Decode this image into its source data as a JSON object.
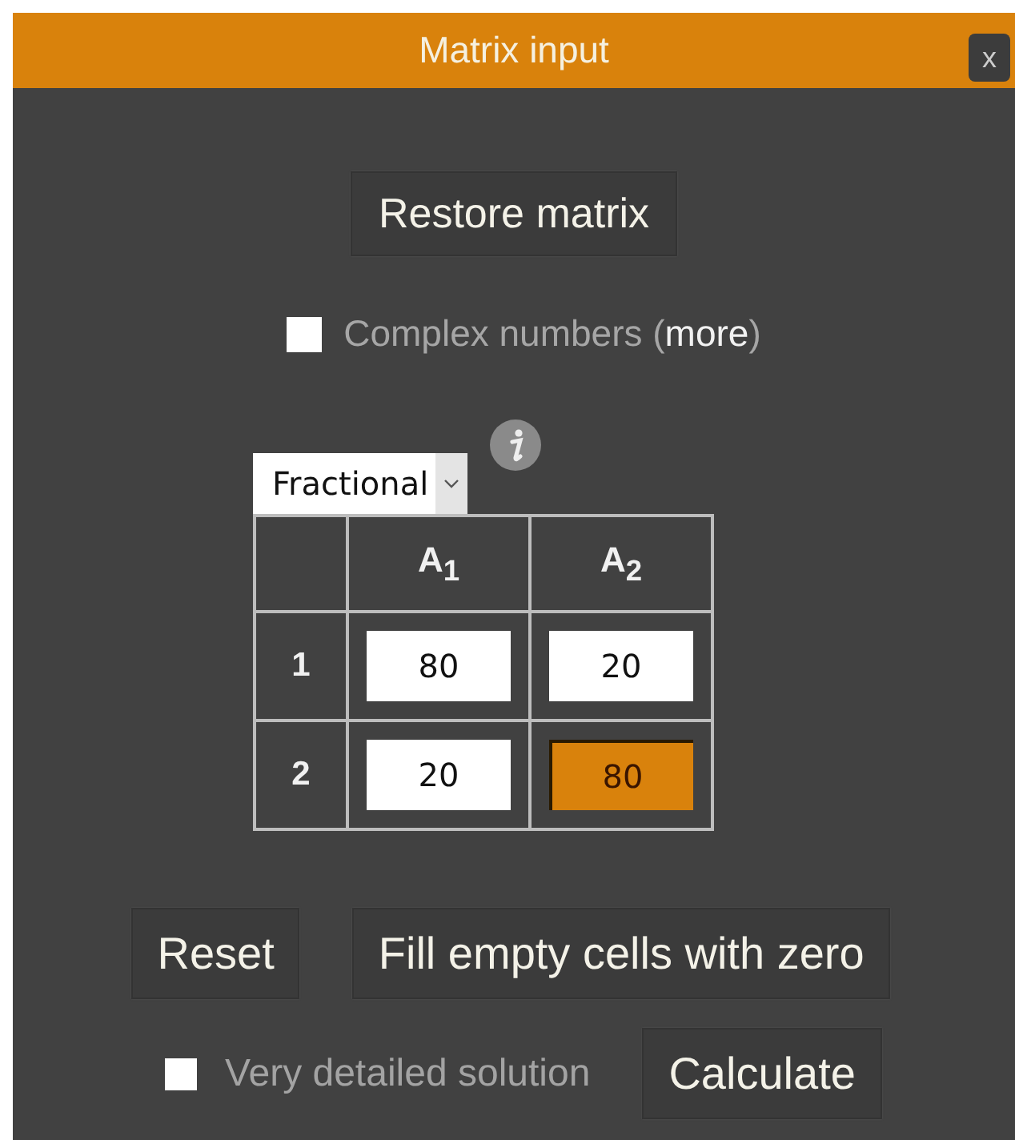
{
  "window": {
    "title": "Matrix input",
    "close": "x"
  },
  "restore_button": "Restore matrix",
  "complex_numbers": {
    "label": "Complex numbers (",
    "link": "more",
    "suffix": ")",
    "checked": false
  },
  "format_select": {
    "value": "Fractional"
  },
  "matrix": {
    "columns": [
      "A$_{1}$",
      "A$_{2}$"
    ],
    "rows": [
      {
        "label": "1",
        "cells": [
          {
            "value": "80",
            "focused": false
          },
          {
            "value": "20",
            "focused": false
          }
        ]
      },
      {
        "label": "2",
        "cells": [
          {
            "value": "20",
            "focused": false
          },
          {
            "value": "80",
            "focused": true
          }
        ]
      }
    ]
  },
  "buttons": [
    "Reset",
    "Fill empty cells with zero"
  ],
  "detailed_solution": {
    "label": "Very detailed solution",
    "checked": false
  },
  "calculate_button": "Calculate"
}
